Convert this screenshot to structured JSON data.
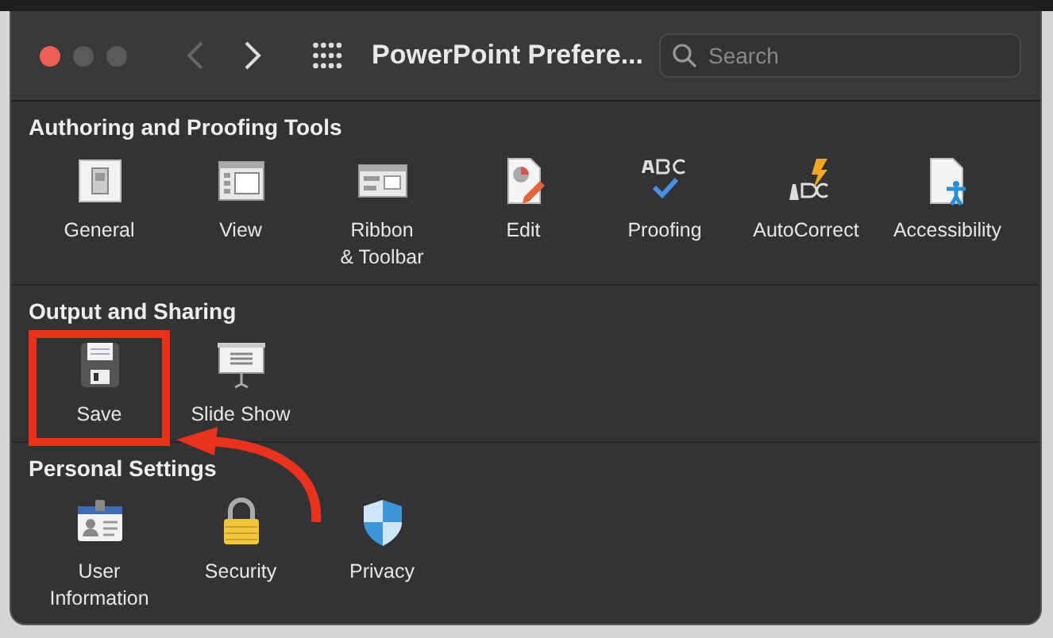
{
  "window": {
    "title": "PowerPoint Prefere...",
    "back_disabled": true,
    "forward_disabled": false
  },
  "search": {
    "placeholder": "Search"
  },
  "sections": [
    {
      "title": "Authoring and Proofing Tools",
      "items": [
        {
          "label": "General",
          "highlighted": false
        },
        {
          "label": "View",
          "highlighted": false
        },
        {
          "label": "Ribbon\n& Toolbar",
          "highlighted": false
        },
        {
          "label": "Edit",
          "highlighted": false
        },
        {
          "label": "Proofing",
          "highlighted": false
        },
        {
          "label": "AutoCorrect",
          "highlighted": false
        },
        {
          "label": "Accessibility",
          "highlighted": false
        }
      ]
    },
    {
      "title": "Output and Sharing",
      "items": [
        {
          "label": "Save",
          "highlighted": true
        },
        {
          "label": "Slide Show",
          "highlighted": false
        }
      ]
    },
    {
      "title": "Personal Settings",
      "items": [
        {
          "label": "User\nInformation",
          "highlighted": false
        },
        {
          "label": "Security",
          "highlighted": false
        },
        {
          "label": "Privacy",
          "highlighted": false
        }
      ]
    }
  ]
}
